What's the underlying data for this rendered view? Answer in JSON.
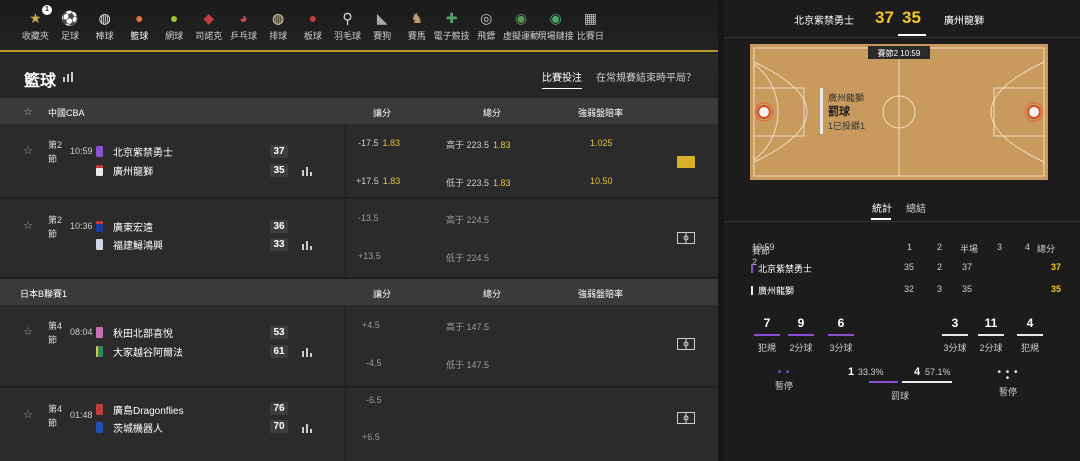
{
  "nav": {
    "items": [
      {
        "label": "收藏夾",
        "icon": "star-icon"
      },
      {
        "label": "足球",
        "icon": "soccer-icon"
      },
      {
        "label": "棒球",
        "icon": "baseball-icon"
      },
      {
        "label": "籃球",
        "icon": "basketball-icon"
      },
      {
        "label": "網球",
        "icon": "tennis-icon"
      },
      {
        "label": "司諾克",
        "icon": "snooker-icon"
      },
      {
        "label": "乒乓球",
        "icon": "table-tennis-icon"
      },
      {
        "label": "排球",
        "icon": "volleyball-icon"
      },
      {
        "label": "板球",
        "icon": "cricket-icon"
      },
      {
        "label": "羽毛球",
        "icon": "badminton-icon"
      },
      {
        "label": "賽狗",
        "icon": "greyhound-icon"
      },
      {
        "label": "賽馬",
        "icon": "horse-racing-icon"
      },
      {
        "label": "電子競技",
        "icon": "gamepad-icon"
      },
      {
        "label": "飛鏢",
        "icon": "darts-icon"
      },
      {
        "label": "虛擬運動",
        "icon": "virtual-sports-icon"
      },
      {
        "label": "現場鏈接",
        "icon": "live-stream-icon"
      },
      {
        "label": "比賽日",
        "icon": "calendar-icon"
      }
    ],
    "favorites_badge": "1",
    "active_index": 3,
    "accent": "#b8962e"
  },
  "page": {
    "title": "籃球",
    "tab_bet": "比賽投注",
    "tab_question": "在常規賽結束時平局？"
  },
  "columns": {
    "handicap": "讓分",
    "total": "總分",
    "moneyline": "強弱盤賠率"
  },
  "leagues": [
    {
      "name": "中國CBA"
    },
    {
      "name": "日本B聯賽1"
    }
  ],
  "matches": [
    {
      "period": "第2節",
      "time": "10:59",
      "home": {
        "name": "北京紫禁勇士",
        "score": "37",
        "color": "#8c4fd0"
      },
      "away": {
        "name": "廣州龍獅",
        "score": "35",
        "color": "#e8e8e8"
      },
      "hcap_home": "-17.5",
      "hcap_home_odds": "1.83",
      "hcap_away": "+17.5",
      "hcap_away_odds": "1.83",
      "over": "高于 223.5",
      "over_odds": "1.83",
      "under": "低于 223.5",
      "under_odds": "1.83",
      "ml_home": "1.025",
      "ml_away": "10.50"
    },
    {
      "period": "第2節",
      "time": "10:36",
      "home": {
        "name": "廣東宏遠",
        "score": "36",
        "color": "#1b3a9a"
      },
      "away": {
        "name": "福建鱘鴻興",
        "score": "33",
        "color": "#cfd7e6"
      },
      "hcap_home": "-13.5",
      "hcap_away": "+13.5",
      "over": "高于 224.5",
      "under": "低于 224.5"
    },
    {
      "period": "第4節",
      "time": "08:04",
      "home": {
        "name": "秋田北部喜悅",
        "score": "53",
        "color": "#c970b5"
      },
      "away": {
        "name": "大家越谷阿爾法",
        "score": "61",
        "color": "#2f8a5a"
      },
      "hcap_home": "+4.5",
      "hcap_away": "-4.5",
      "over": "高于 147.5",
      "under": "低于 147.5"
    },
    {
      "period": "第4節",
      "time": "01:48",
      "home": {
        "name": "廣島Dragonflies",
        "score": "76",
        "color": "#c23a3a"
      },
      "away": {
        "name": "茨城機器人",
        "score": "70",
        "color": "#1f4fb5"
      },
      "hcap_home": "-6.5",
      "hcap_away": "+6.5"
    }
  ],
  "scoreboard": {
    "home": "北京紫禁勇士",
    "home_score": "37",
    "away_score": "35",
    "away": "廣州龍獅",
    "court": {
      "status": "賽節2 10:59",
      "team": "廣州龍獅",
      "event": "罰球",
      "detail": "1已投餵1"
    },
    "tab_stats": "統計",
    "tab_summary": "總結",
    "table": {
      "period": "賽節2",
      "clock": "10:59",
      "headers": [
        "1",
        "2",
        "半場",
        "3",
        "4",
        "總分"
      ],
      "rows": [
        {
          "team": "北京紫禁勇士",
          "color": "#8c4fd0",
          "q1": "35",
          "q2": "2",
          "half": "37",
          "q3": "",
          "q4": "",
          "total": "37"
        },
        {
          "team": "廣州龍獅",
          "color": "#e8e8e8",
          "q1": "32",
          "q2": "3",
          "half": "35",
          "q3": "",
          "q4": "",
          "total": "35"
        }
      ]
    },
    "home_stats": [
      {
        "v": "7",
        "l": "犯規"
      },
      {
        "v": "9",
        "l": "2分球"
      },
      {
        "v": "6",
        "l": "3分球"
      }
    ],
    "away_stats": [
      {
        "v": "3",
        "l": "3分球"
      },
      {
        "v": "11",
        "l": "2分球"
      },
      {
        "v": "4",
        "l": "犯規"
      }
    ],
    "timeout_label": "暫停",
    "ft": {
      "home_made": "1",
      "home_pct": "33.3%",
      "away_made": "4",
      "away_pct": "57.1%",
      "label": "罰球",
      "home_share": 0.333,
      "away_share": 0.571
    },
    "home_color": "#8c4fd0",
    "away_color": "#e8e8e8",
    "highlight": "#f3c623"
  }
}
